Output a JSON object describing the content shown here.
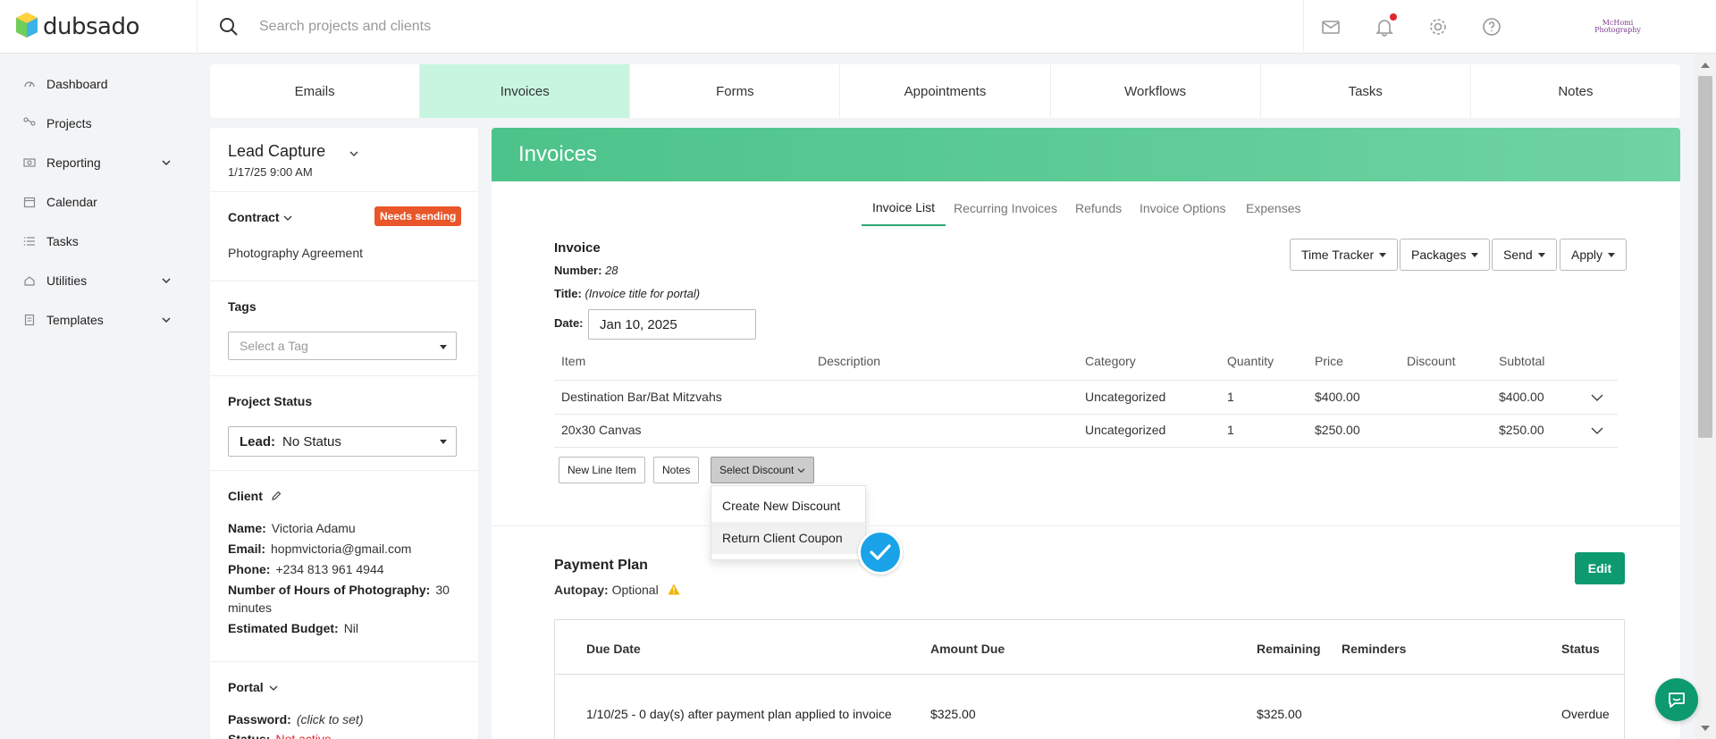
{
  "app": {
    "logo_text": "dubsado"
  },
  "search": {
    "placeholder": "Search projects and clients"
  },
  "topbar": {
    "icons": [
      "mail-icon",
      "bell-icon",
      "gear-icon",
      "help-icon"
    ],
    "avatar_text": "McHomi Photography"
  },
  "sidebar": {
    "items": [
      {
        "label": "Dashboard",
        "icon": "dashboard-icon",
        "has_chevron": false
      },
      {
        "label": "Projects",
        "icon": "projects-icon",
        "has_chevron": false
      },
      {
        "label": "Reporting",
        "icon": "reporting-icon",
        "has_chevron": true
      },
      {
        "label": "Calendar",
        "icon": "calendar-icon",
        "has_chevron": false
      },
      {
        "label": "Tasks",
        "icon": "tasks-icon",
        "has_chevron": false
      },
      {
        "label": "Utilities",
        "icon": "utilities-icon",
        "has_chevron": true
      },
      {
        "label": "Templates",
        "icon": "templates-icon",
        "has_chevron": true
      }
    ]
  },
  "main_tabs": {
    "items": [
      "Emails",
      "Invoices",
      "Forms",
      "Appointments",
      "Workflows",
      "Tasks",
      "Notes"
    ],
    "active": "Invoices"
  },
  "project": {
    "title": "Lead Capture",
    "date": "1/17/25 9:00 AM",
    "contract_label": "Contract",
    "contract_badge": "Needs sending",
    "contract_name": "Photography Agreement",
    "tags_label": "Tags",
    "tags_placeholder": "Select a Tag",
    "status_label": "Project Status",
    "status_prefix": "Lead:",
    "status_value": "No Status",
    "client_label": "Client",
    "client": {
      "name_label": "Name:",
      "name": "Victoria Adamu",
      "email_label": "Email:",
      "email": "hopmvictoria@gmail.com",
      "phone_label": "Phone:",
      "phone": "+234 813 961 4944",
      "hours_label": "Number of Hours of Photography:",
      "hours": "30 minutes",
      "budget_label": "Estimated Budget:",
      "budget": "Nil"
    },
    "portal_label": "Portal",
    "password_label": "Password:",
    "password_value": "(click to set)",
    "status_row_label": "Status:",
    "status_row_value": "Not active"
  },
  "invoices": {
    "header": "Invoices",
    "sub_tabs": [
      "Invoice List",
      "Recurring Invoices",
      "Refunds",
      "Invoice Options",
      "Expenses"
    ],
    "active_sub_tab": "Invoice List",
    "invoice_label": "Invoice",
    "number_label": "Number:",
    "number_value": "28",
    "title_label": "Title:",
    "title_value": "(Invoice title for portal)",
    "date_label": "Date:",
    "date_value": "Jan 10, 2025",
    "action_buttons": [
      "Time Tracker",
      "Packages",
      "Send",
      "Apply"
    ],
    "table": {
      "columns": [
        "Item",
        "Description",
        "Category",
        "Quantity",
        "Price",
        "Discount",
        "Subtotal"
      ],
      "rows": [
        {
          "item": "Destination Bar/Bat Mitzvahs",
          "description": "",
          "category": "Uncategorized",
          "quantity": "1",
          "price": "$400.00",
          "discount": "",
          "subtotal": "$400.00"
        },
        {
          "item": "20x30 Canvas",
          "description": "",
          "category": "Uncategorized",
          "quantity": "1",
          "price": "$250.00",
          "discount": "",
          "subtotal": "$250.00"
        }
      ]
    },
    "buttons": {
      "new_line_item": "New Line Item",
      "notes": "Notes",
      "select_discount": "Select Discount"
    },
    "discount_menu": [
      "Create New Discount",
      "Return Client Coupon"
    ],
    "payment_plan": {
      "title": "Payment Plan",
      "autopay_label": "Autopay:",
      "autopay_value": "Optional",
      "edit_label": "Edit",
      "columns": [
        "Due Date",
        "Amount Due",
        "Remaining",
        "Reminders",
        "Status"
      ],
      "rows": [
        {
          "due_date": "1/10/25 - 0 day(s) after payment plan applied to invoice",
          "amount_due": "$325.00",
          "remaining": "$325.00",
          "reminders": "",
          "status": "Overdue"
        }
      ]
    }
  },
  "colors": {
    "accent_green": "#0d9a6e",
    "active_tab_bg": "#c8f5e0",
    "header_green": "#4cc38a",
    "badge_orange": "#e8562a",
    "check_blue": "#1aa3e8",
    "warning_yellow": "#f0b400",
    "not_active_red": "#e0262e"
  }
}
